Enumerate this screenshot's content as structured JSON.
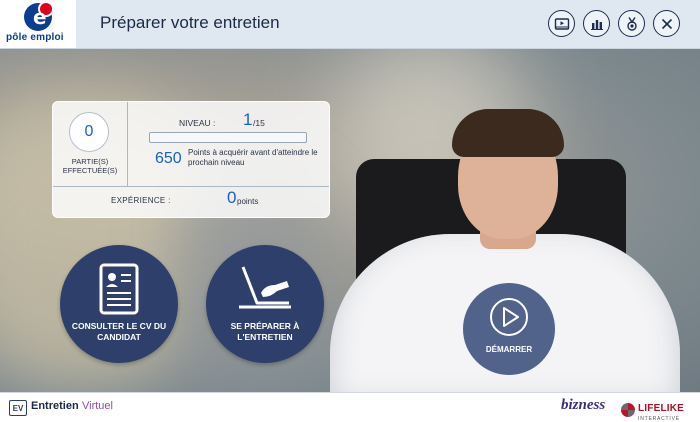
{
  "header": {
    "logo_text": "pôle emploi",
    "logo_letter": "e",
    "title": "Préparer votre entretien",
    "buttons": [
      {
        "name": "video-icon"
      },
      {
        "name": "chart-icon"
      },
      {
        "name": "medal-icon"
      },
      {
        "name": "close-icon"
      }
    ]
  },
  "stats": {
    "parties_count": "0",
    "parties_label": "PARTIE(S) EFFECTUÉE(S)",
    "niveau_label": "NIVEAU :",
    "niveau_value": "1",
    "niveau_max": "/15",
    "level_progress": 0.0,
    "points_value": "650",
    "points_text": "Points à acquérir avant d'atteindre le prochain niveau",
    "experience_label": "EXPÉRIENCE :",
    "experience_value": "0",
    "experience_unit": "points"
  },
  "actions": {
    "cv_label": "CONSULTER LE CV DU CANDIDAT",
    "prepare_label": "SE PRÉPARER À L'ENTRETIEN",
    "start_label": "DÉMARRER"
  },
  "footer": {
    "badge": "EV",
    "title": "Entretien",
    "subtitle": "Virtuel",
    "partner1": "bizness",
    "partner2": "LIFELIKE",
    "partner2_sub": "INTERACTIVE"
  },
  "colors": {
    "accent": "#1a5fc9",
    "button_bg": "#2e3f6b",
    "header_bg": "#dfe8f1"
  }
}
